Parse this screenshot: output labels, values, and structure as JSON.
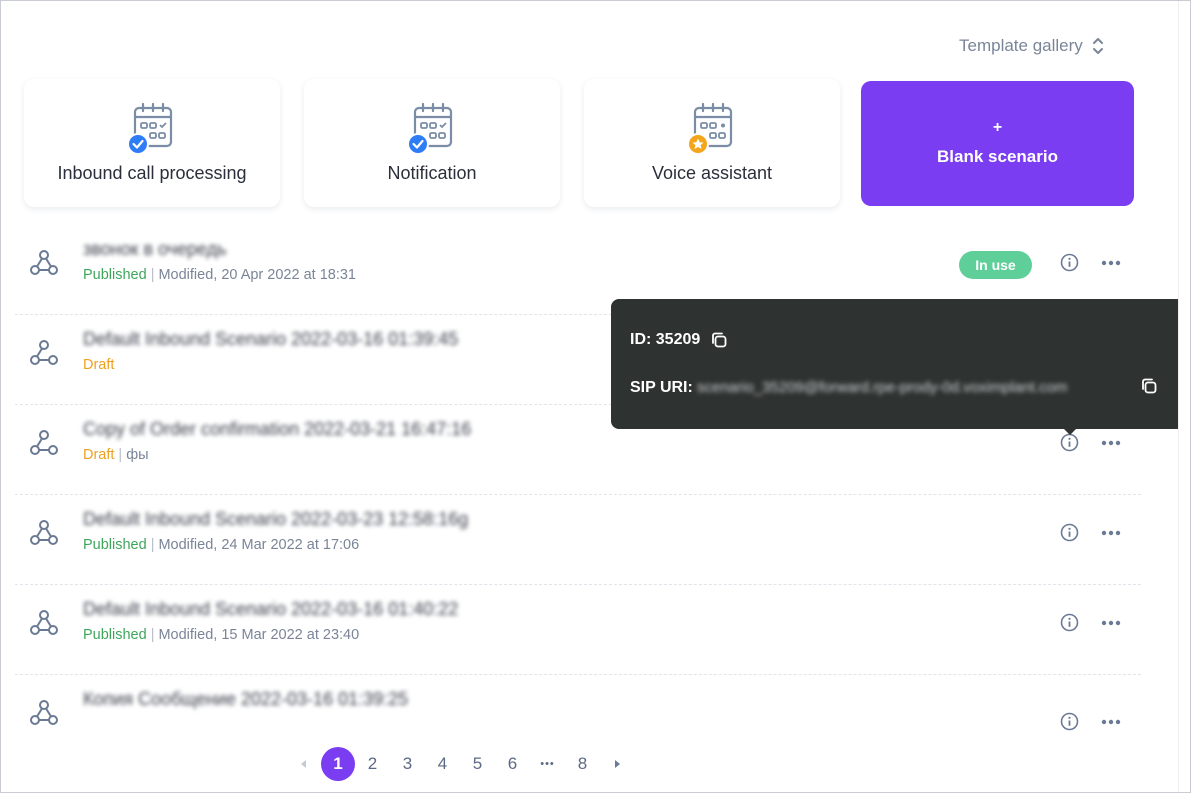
{
  "header": {
    "template_gallery_label": "Template gallery"
  },
  "templates": [
    {
      "title": "Inbound call processing"
    },
    {
      "title": "Notification"
    },
    {
      "title": "Voice assistant"
    }
  ],
  "blank": {
    "plus": "+",
    "title": "Blank scenario"
  },
  "rows": [
    {
      "name": "звонок в очередь",
      "status": "Published",
      "modified": "Modified, 20 Apr 2022 at 18:31",
      "badge": "In use"
    },
    {
      "name": "Default Inbound Scenario 2022-03-16 01:39:45",
      "status": "Draft",
      "modified": ""
    },
    {
      "name": "Copy of Order confirmation 2022-03-21 16:47:16",
      "status": "Draft",
      "modified": "фы"
    },
    {
      "name": "Default Inbound Scenario 2022-03-23 12:58:16g",
      "status": "Published",
      "modified": "Modified, 24 Mar 2022 at 17:06"
    },
    {
      "name": "Default Inbound Scenario 2022-03-16 01:40:22",
      "status": "Published",
      "modified": "Modified, 15 Mar 2022 at 23:40"
    },
    {
      "name": "Копия Сообщение 2022-03-16 01:39:25",
      "status": "",
      "modified": ""
    }
  ],
  "tooltip": {
    "id_label": "ID: 35209",
    "sip_label": "SIP URI:",
    "sip_value": "scenario_35209@forward.rpe-prody-0d.voximplant.com"
  },
  "pagination": {
    "pages": [
      "1",
      "2",
      "3",
      "4",
      "5",
      "6",
      "•••",
      "8"
    ],
    "current": "1"
  },
  "colors": {
    "accent": "#7a3df2",
    "published": "#3ea65b",
    "draft": "#f0a020",
    "badge": "#5fcf9a",
    "tooltip_bg": "#2e3230"
  },
  "icons": {
    "template": "calendar-icon",
    "check": "check-badge-icon",
    "star": "star-badge-icon",
    "row": "flow-icon",
    "info": "info-icon",
    "more": "more-icon",
    "copy": "copy-icon"
  }
}
